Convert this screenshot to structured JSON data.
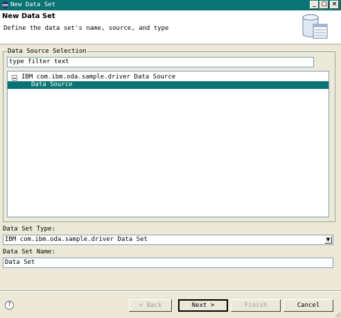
{
  "window": {
    "title": "New Data Set",
    "title_color": "#0a7373"
  },
  "header": {
    "heading": "New Data Set",
    "description": "Define the data set's name, source, and type"
  },
  "datasource": {
    "group_label": "Data Source Selection",
    "filter_value": "type filter text",
    "tree": [
      {
        "label": "IBM com.ibm.oda.sample.driver Data Source",
        "expanded": true
      },
      {
        "label": "Data Source",
        "selected": true
      }
    ]
  },
  "dataset_type": {
    "label": "Data Set Type:",
    "value": "IBM com.ibm.oda.sample.driver Data Set"
  },
  "dataset_name": {
    "label": "Data Set Name:",
    "value": "Data Set"
  },
  "buttons": {
    "help": "?",
    "back": "< Back",
    "next": "Next >",
    "finish": "Finish",
    "cancel": "Cancel"
  }
}
